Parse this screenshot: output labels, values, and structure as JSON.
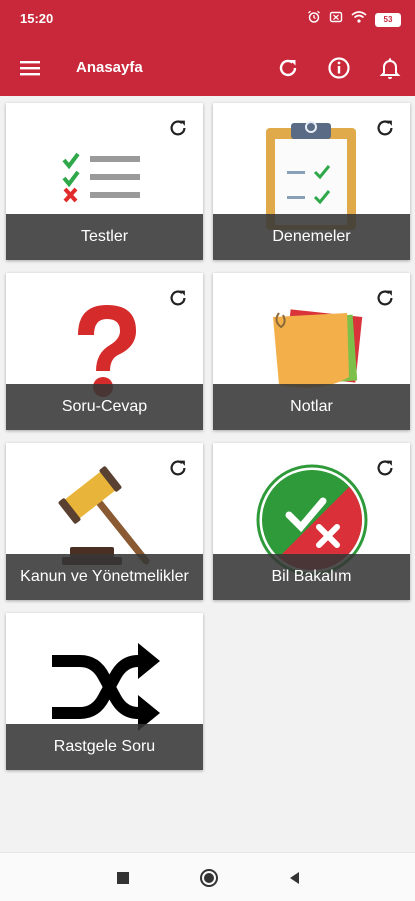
{
  "status_bar": {
    "time": "15:20",
    "battery": "53",
    "icons": [
      "alarm-icon",
      "screen-record-icon",
      "wifi-icon",
      "battery-icon"
    ]
  },
  "toolbar": {
    "title": "Anasayfa",
    "icons": [
      "menu-icon",
      "refresh-icon",
      "info-icon",
      "bell-icon"
    ]
  },
  "tiles": [
    {
      "label": "Testler",
      "icon": "checklist-icon"
    },
    {
      "label": "Denemeler",
      "icon": "clipboard-icon"
    },
    {
      "label": "Soru-Cevap",
      "icon": "question-mark-icon"
    },
    {
      "label": "Notlar",
      "icon": "sticky-notes-icon"
    },
    {
      "label": "Kanun ve Yönetmelikler",
      "icon": "gavel-icon"
    },
    {
      "label": "Bil Bakalım",
      "icon": "true-false-icon"
    },
    {
      "label": "Rastgele Soru",
      "icon": "shuffle-icon"
    }
  ],
  "nav_bar": {
    "buttons": [
      "recents-button",
      "home-button",
      "back-button"
    ]
  },
  "colors": {
    "primary": "#c8283a",
    "label_bar": "#3a3a3a",
    "background": "#f2f2f2"
  }
}
